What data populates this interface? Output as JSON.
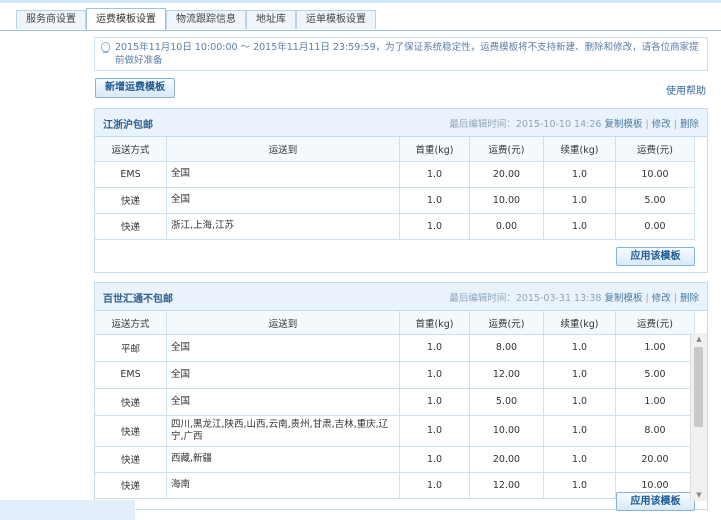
{
  "tabs": [
    {
      "label": "服务商设置",
      "active": false
    },
    {
      "label": "运费模板设置",
      "active": true
    },
    {
      "label": "物流跟踪信息",
      "active": false
    },
    {
      "label": "地址库",
      "active": false
    },
    {
      "label": "运单模板设置",
      "active": false
    }
  ],
  "notice": {
    "icon": "lightbulb-icon",
    "text": "2015年11月10日 10:00:00 ～ 2015年11月11日 23:59:59，为了保证系统稳定性，运费模板将不支持新建、删除和修改，请各位商家提前做好准备"
  },
  "toolbar": {
    "new_template_label": "新增运费模板",
    "help_label": "使用帮助"
  },
  "columns": [
    "运送方式",
    "运送到",
    "首重(kg)",
    "运费(元)",
    "续重(kg)",
    "运费(元)"
  ],
  "templates": [
    {
      "name": "江浙沪包邮",
      "last_edit_label": "最后编辑时间：2015-10-10 14:26",
      "copy_label": "复制模板",
      "edit_label": "修改",
      "delete_label": "删除",
      "apply_label": "应用该模板",
      "rows": [
        [
          "EMS",
          "全国",
          "1.0",
          "20.00",
          "1.0",
          "10.00"
        ],
        [
          "快递",
          "全国",
          "1.0",
          "10.00",
          "1.0",
          "5.00"
        ],
        [
          "快递",
          "浙江,上海,江苏",
          "1.0",
          "0.00",
          "1.0",
          "0.00"
        ]
      ]
    },
    {
      "name": "百世汇通不包邮",
      "last_edit_label": "最后编辑时间：2015-03-31 13:38",
      "copy_label": "复制模板",
      "edit_label": "修改",
      "delete_label": "删除",
      "apply_label": "应用该模板",
      "rows": [
        [
          "平邮",
          "全国",
          "1.0",
          "8.00",
          "1.0",
          "1.00"
        ],
        [
          "EMS",
          "全国",
          "1.0",
          "12.00",
          "1.0",
          "5.00"
        ],
        [
          "快递",
          "全国",
          "1.0",
          "5.00",
          "1.0",
          "1.00"
        ],
        [
          "快递",
          "四川,黑龙江,陕西,山西,云南,贵州,甘肃,吉林,重庆,辽宁,广西",
          "1.0",
          "10.00",
          "1.0",
          "8.00"
        ],
        [
          "快递",
          "西藏,新疆",
          "1.0",
          "20.00",
          "1.0",
          "20.00"
        ],
        [
          "快递",
          "海南",
          "1.0",
          "12.00",
          "1.0",
          "10.00"
        ]
      ]
    }
  ]
}
